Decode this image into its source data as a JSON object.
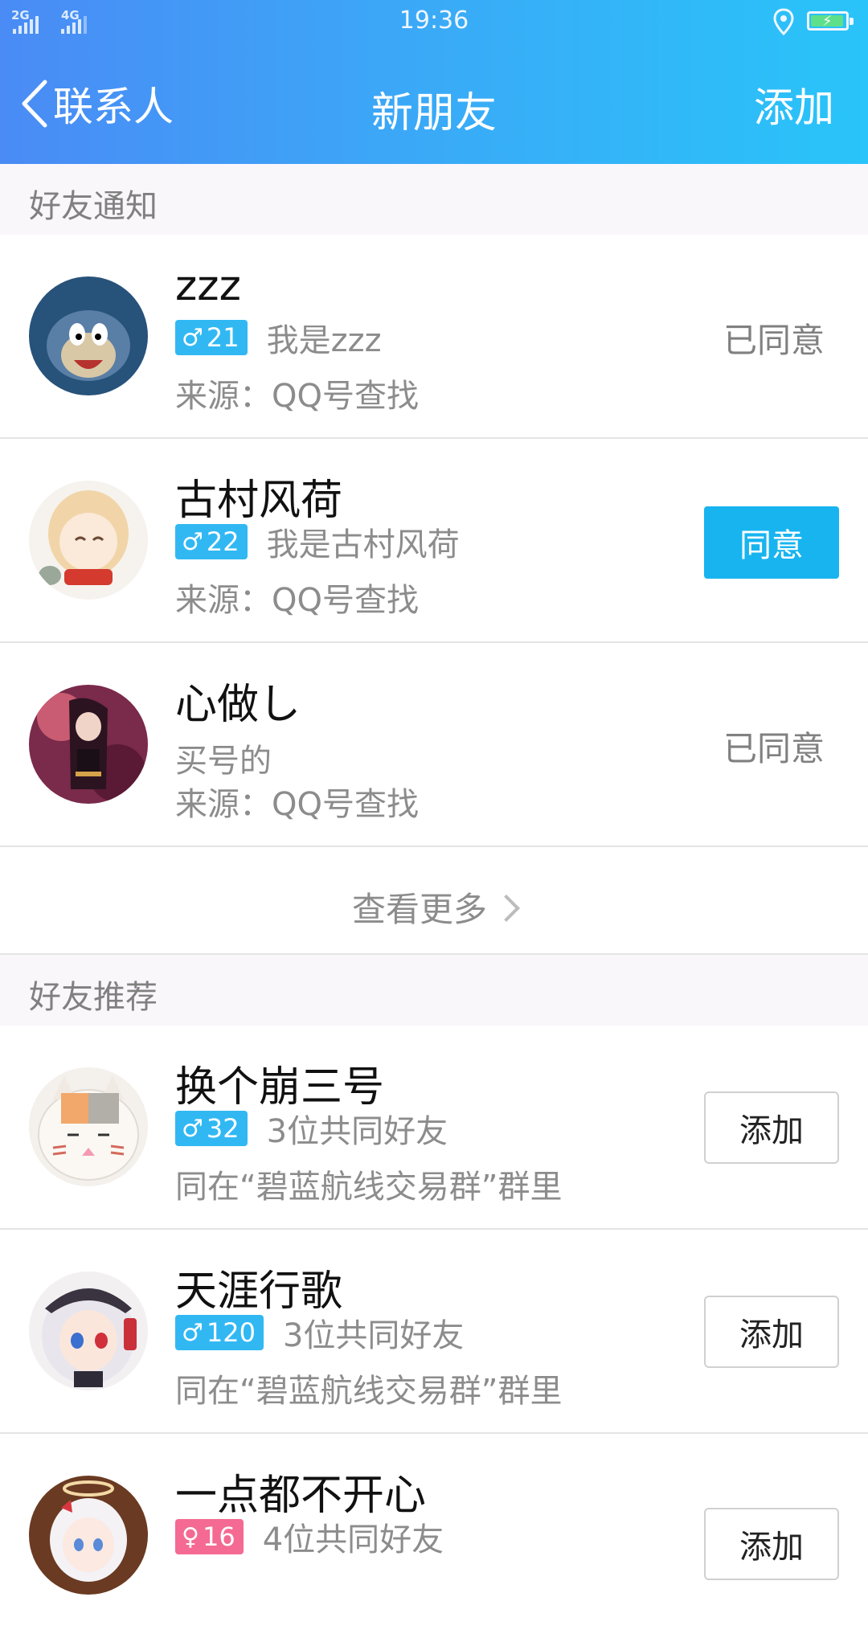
{
  "status_bar": {
    "network_1": "2G",
    "network_2": "4G",
    "time": "19:36",
    "icons": [
      "signal-icon",
      "location-icon",
      "battery-charging-icon"
    ]
  },
  "header": {
    "back_label": "联系人",
    "title": "新朋友",
    "add_label": "添加"
  },
  "notifications": {
    "section_label": "好友通知",
    "items": [
      {
        "name": "zzz",
        "age": "21",
        "gender": "male",
        "message": "我是zzz",
        "source": "来源：QQ号查找",
        "status": "已同意"
      },
      {
        "name": "古村风荷",
        "age": "22",
        "gender": "male",
        "message": "我是古村风荷",
        "source": "来源：QQ号查找",
        "action": "同意"
      },
      {
        "name": "心做し",
        "message": "买号的",
        "source": "来源：QQ号查找",
        "status": "已同意"
      }
    ],
    "see_more": "查看更多"
  },
  "recommendations": {
    "section_label": "好友推荐",
    "items": [
      {
        "name": "换个崩三号",
        "age": "32",
        "gender": "male",
        "mutual": "3位共同好友",
        "group": "同在“碧蓝航线交易群”群里",
        "action": "添加"
      },
      {
        "name": "天涯行歌",
        "age": "120",
        "gender": "male",
        "mutual": "3位共同好友",
        "group": "同在“碧蓝航线交易群”群里",
        "action": "添加"
      },
      {
        "name": "一点都不开心",
        "age": "16",
        "gender": "female",
        "mutual": "4位共同好友",
        "action": "添加"
      }
    ]
  },
  "colors": {
    "header_start": "#4a8bf5",
    "header_end": "#29c4f9",
    "badge_male": "#31b8f3",
    "badge_female": "#f46a92",
    "agree_button": "#18b4f0"
  }
}
